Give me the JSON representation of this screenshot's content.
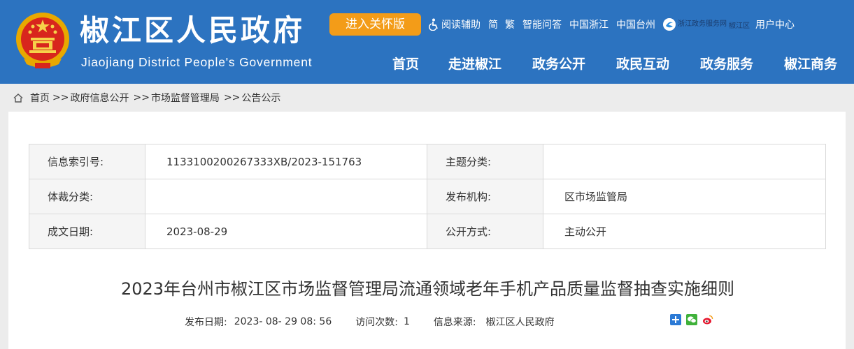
{
  "header": {
    "site_title": "椒江区人民政府",
    "site_subtitle": "Jiaojiang District People's Government",
    "care_version_label": "进入关怀版",
    "utility_links": [
      {
        "label": "阅读辅助",
        "icon": "accessibility-icon"
      },
      {
        "label": "简"
      },
      {
        "label": "繁"
      },
      {
        "label": "智能问答"
      },
      {
        "label": "中国浙江"
      },
      {
        "label": "中国台州"
      }
    ],
    "zw_logo_text": "浙江政务服务网",
    "zw_logo_region": "椒江区",
    "user_center_label": "用户中心",
    "nav": [
      "首页",
      "走进椒江",
      "政务公开",
      "政民互动",
      "政务服务",
      "椒江商务"
    ],
    "colors": {
      "header_bg": "#2c73c0",
      "care_button": "#f39c18"
    }
  },
  "breadcrumb": {
    "items": [
      "首页",
      "政府信息公开",
      "市场监督管理局",
      "公告公示"
    ],
    "separator": ">>"
  },
  "meta": {
    "rows": [
      {
        "label1": "信息索引号:",
        "value1": "113310020026733​3XB/2023-151763",
        "label2": "主题分类:",
        "value2": ""
      },
      {
        "label1": "体裁分类:",
        "value1": "",
        "label2": "发布机构:",
        "value2": "区市场监管局"
      },
      {
        "label1": "成文日期:",
        "value1": "2023-08-29",
        "label2": "公开方式:",
        "value2": "主动公开"
      }
    ]
  },
  "article": {
    "title": "2023年台州市椒江区市场监督管理局流通领域老年手机产品质量监督抽查实施细则",
    "publish_label": "发布日期:",
    "publish_date": "2023- 08- 29 08: 56",
    "visits_label": "访问次数:",
    "visits": "1",
    "source_label": "信息来源:",
    "source": "椒江区人民政府"
  },
  "share": [
    "share-plus-icon",
    "wechat-icon",
    "weibo-icon"
  ]
}
